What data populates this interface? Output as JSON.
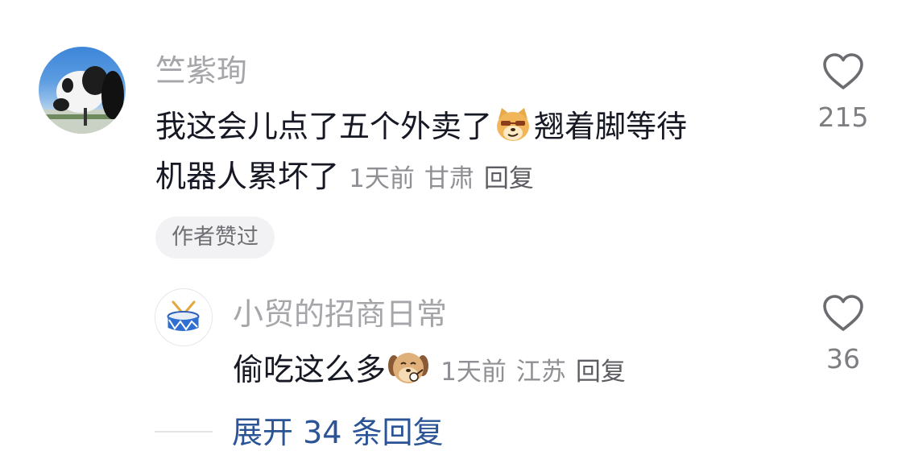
{
  "comment": {
    "author": "竺紫珣",
    "text_line1_before_emoji": "我这会儿点了五个外卖了",
    "emoji_1": "sly-dog-emoji",
    "text_line1_after_emoji": "翘着脚等待",
    "text_line2": "机器人累坏了",
    "time": "1天前",
    "location": "甘肃",
    "reply_label": "回复",
    "badge": "作者赞过",
    "like_count": "215"
  },
  "reply": {
    "author": "小贸的招商日常",
    "text_before_emoji": "偷吃这么多",
    "emoji_1": "eating-dog-emoji",
    "time": "1天前",
    "location": "江苏",
    "reply_label": "回复",
    "like_count": "36"
  },
  "expand": {
    "label": "展开 34 条回复"
  },
  "colors": {
    "name": "#a6a6aa",
    "body": "#161823",
    "meta": "#8f8f94",
    "link": "#2b5496"
  }
}
